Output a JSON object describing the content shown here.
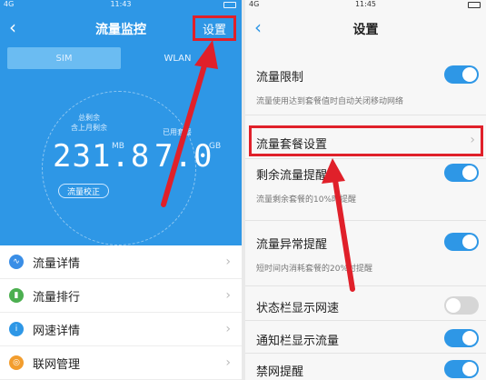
{
  "left": {
    "status": {
      "time": "11:43",
      "signal": "4G"
    },
    "header": {
      "title": "流量监控",
      "settings_label": "设置"
    },
    "tabs": [
      {
        "label": "SIM"
      },
      {
        "label": "WLAN"
      }
    ],
    "gauge": {
      "remain_caption_1": "总剩余",
      "remain_caption_2": "含上月剩余",
      "remain_value": "231.8",
      "remain_unit": "MB",
      "plan_caption": "已用套餐",
      "plan_value": "7.0",
      "plan_unit": "GB",
      "calibrate_label": "流量校正"
    },
    "list": [
      {
        "label": "流量详情",
        "icon": "wave-icon",
        "color": "#3a8ee6",
        "glyph": "∿"
      },
      {
        "label": "流量排行",
        "icon": "bars-icon",
        "color": "#4caf50",
        "glyph": "▮"
      },
      {
        "label": "网速详情",
        "icon": "info-icon",
        "color": "#2e97e6",
        "glyph": "i"
      },
      {
        "label": "联网管理",
        "icon": "globe-icon",
        "color": "#f29d2e",
        "glyph": "◎"
      }
    ]
  },
  "right": {
    "status": {
      "time": "11:45",
      "signal": "4G"
    },
    "header": {
      "title": "设置"
    },
    "settings": [
      {
        "title": "流量限制",
        "desc": "流量使用达到套餐值时自动关闭移动网络",
        "toggle": "on"
      },
      {
        "title": "流量套餐设置",
        "desc": "",
        "toggle": "chevron"
      },
      {
        "title": "剩余流量提醒",
        "desc": "流量剩余套餐的10%时提醒",
        "toggle": "on"
      },
      {
        "title": "流量异常提醒",
        "desc": "短时间内消耗套餐的20%时提醒",
        "toggle": "on"
      },
      {
        "title": "状态栏显示网速",
        "desc": "",
        "toggle": "off"
      },
      {
        "title": "通知栏显示流量",
        "desc": "",
        "toggle": "on"
      },
      {
        "title": "禁网提醒",
        "desc": "",
        "toggle": "on"
      }
    ]
  },
  "colors": {
    "accent": "#2e97e6",
    "annotation": "#e0202a"
  }
}
